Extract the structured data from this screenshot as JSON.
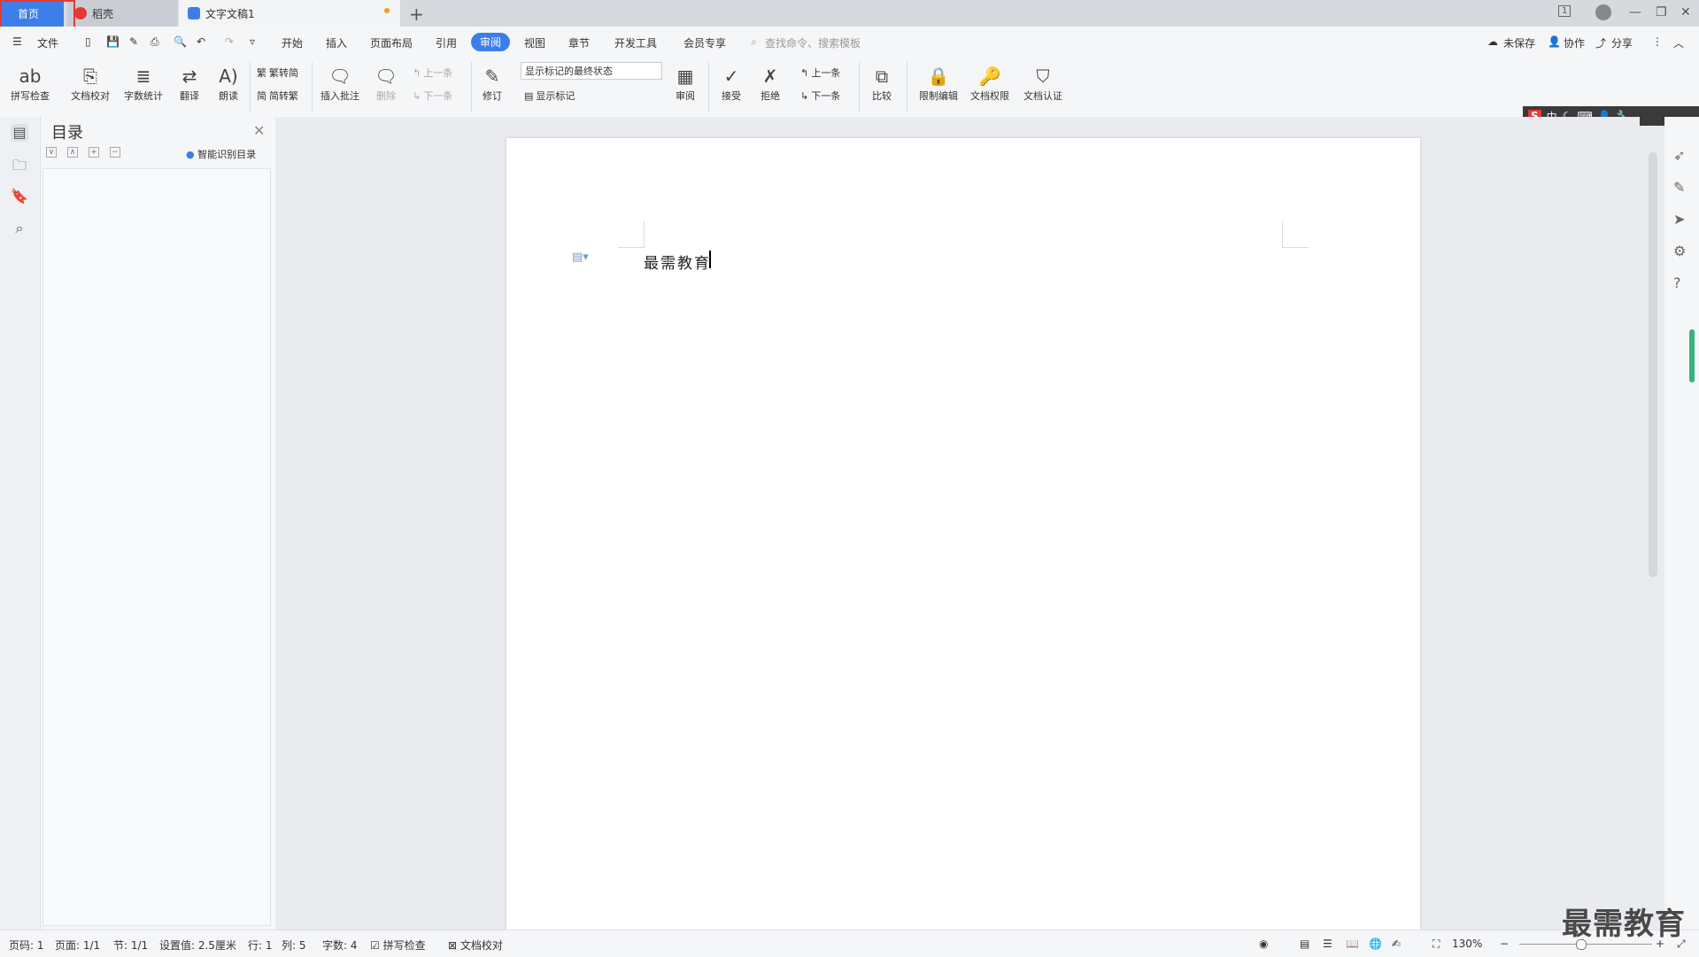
{
  "tabs": {
    "home": "首页",
    "daoke": "稻壳",
    "doc": "文字文稿1",
    "add": "+"
  },
  "window": {
    "win1": "1",
    "minimize": "—",
    "restore": "❐",
    "close": "✕"
  },
  "menu": {
    "file": "文件",
    "start": "开始",
    "insert": "插入",
    "layout": "页面布局",
    "ref": "引用",
    "review": "审阅",
    "view": "视图",
    "chapter": "章节",
    "dev": "开发工具",
    "member": "会员专享",
    "search_placeholder": "查找命令、搜索模板",
    "unsaved": "未保存",
    "collab": "协作",
    "share": "分享"
  },
  "ribbon": {
    "spell": "拼写检查",
    "proof": "文档校对",
    "wordcount": "字数统计",
    "translate": "翻译",
    "read": "朗读",
    "t2s": "繁转简",
    "s2t": "简转繁",
    "insert_comment": "插入批注",
    "delete": "删除",
    "prev": "上一条",
    "next": "下一条",
    "revise": "修订",
    "markup_state": "显示标记的最终状态",
    "show_markup": "显示标记",
    "review": "审阅",
    "accept": "接受",
    "reject": "拒绝",
    "prev2": "上一条",
    "next2": "下一条",
    "compare": "比较",
    "restrict": "限制编辑",
    "perm": "文档权限",
    "cert": "文档认证"
  },
  "toc": {
    "title": "目录",
    "smart": "智能识别目录",
    "close": "✕"
  },
  "document": {
    "text": "最需教育"
  },
  "ime": {
    "s": "S",
    "lang": "中"
  },
  "status": {
    "pagenum": "页码: 1",
    "pages": "页面: 1/1",
    "section": "节: 1/1",
    "setting": "设置值: 2.5厘米",
    "row": "行: 1",
    "col": "列: 5",
    "words": "字数: 4",
    "spell": "拼写检查",
    "proof": "文档校对",
    "zoom": "130%"
  },
  "watermark": "最需教育",
  "colors": {
    "accent": "#3d7fe8",
    "highlight": "#e53935",
    "green": "#36b37e"
  }
}
